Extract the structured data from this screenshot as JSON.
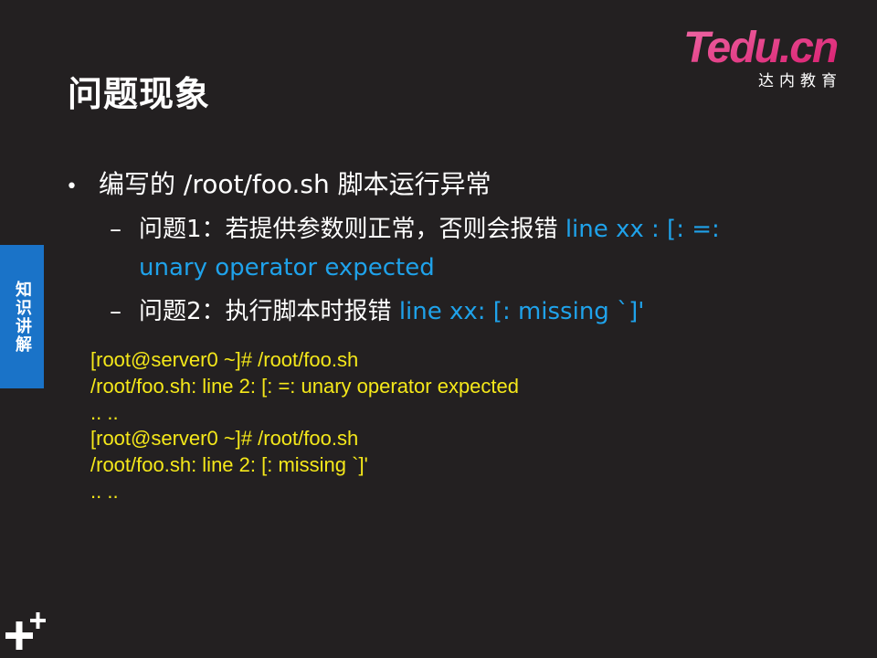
{
  "slide": {
    "title": "问题现象",
    "side_tab": "知识讲解"
  },
  "logo": {
    "brand": "Tedu.cn",
    "subtitle": "达内教育"
  },
  "bullet": {
    "text": "编写的 /root/foo.sh 脚本运行异常",
    "sub_items": [
      {
        "text": "问题1：若提供参数则正常，否则会报错",
        "highlight": "line xx : [: =:",
        "continuation": "unary operator expected"
      },
      {
        "text": "问题2：执行脚本时报错",
        "highlight": "line xx: [: missing `]'"
      }
    ]
  },
  "code_lines": [
    "[root@server0 ~]# /root/foo.sh",
    "/root/foo.sh: line 2: [: =: unary operator expected",
    ".. ..",
    "[root@server0 ~]# /root/foo.sh",
    "/root/foo.sh: line 2: [: missing `]'",
    ".. .."
  ],
  "colors": {
    "background": "#232021",
    "accent_blue": "#1fa2ea",
    "code_yellow": "#f5e81a",
    "side_tab": "#1a73c8",
    "logo_magenta": "#e6247d"
  },
  "icons": {
    "bullet": "bullet-dot-icon",
    "footer": "plus-icon"
  }
}
